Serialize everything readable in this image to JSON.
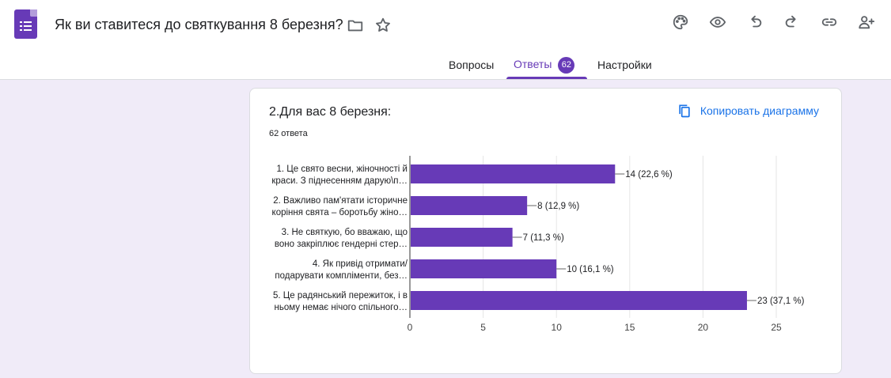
{
  "header": {
    "title": "Як ви ставитеся до святкування 8 березня?",
    "icons": [
      "folder-icon",
      "star-icon",
      "palette-icon",
      "preview-eye-icon",
      "undo-icon",
      "redo-icon",
      "link-icon",
      "add-collaborator-icon"
    ]
  },
  "tabs": {
    "questions": "Вопросы",
    "responses": "Ответы",
    "responses_count": "62",
    "settings": "Настройки",
    "active": "responses"
  },
  "colors": {
    "accent": "#673ab7",
    "bar": "#673ab7",
    "link": "#1a73e8",
    "page_bg": "#f0ebf8"
  },
  "card": {
    "question": "2.Для вас 8 березня:",
    "answers_count": "62 ответа",
    "copy_label": "Копировать диаграмму"
  },
  "chart_data": {
    "type": "bar",
    "orientation": "horizontal",
    "categories": [
      [
        "1. Це свято весни, жіночності й",
        "краси. З піднесенням дарую\\п…"
      ],
      [
        "2. Важливо пам'ятати історичне",
        "коріння свята – боротьбу жіно…"
      ],
      [
        "3. Не святкую, бо вважаю, що",
        "воно закріплює гендерні стер…"
      ],
      [
        "4. Як привід отримати/",
        "подарувати компліменти, без…"
      ],
      [
        "5. Це радянський пережиток, і в",
        "ньому немає нічого спільного…"
      ]
    ],
    "values": [
      14,
      8,
      7,
      10,
      23
    ],
    "value_labels": [
      "14 (22,6 %)",
      "8 (12,9 %)",
      "7 (11,3 %)",
      "10 (16,1 %)",
      "23 (37,1 %)"
    ],
    "xticks": [
      "0",
      "5",
      "10",
      "15",
      "20",
      "25"
    ],
    "xlim": [
      0,
      25
    ],
    "grid": true
  }
}
